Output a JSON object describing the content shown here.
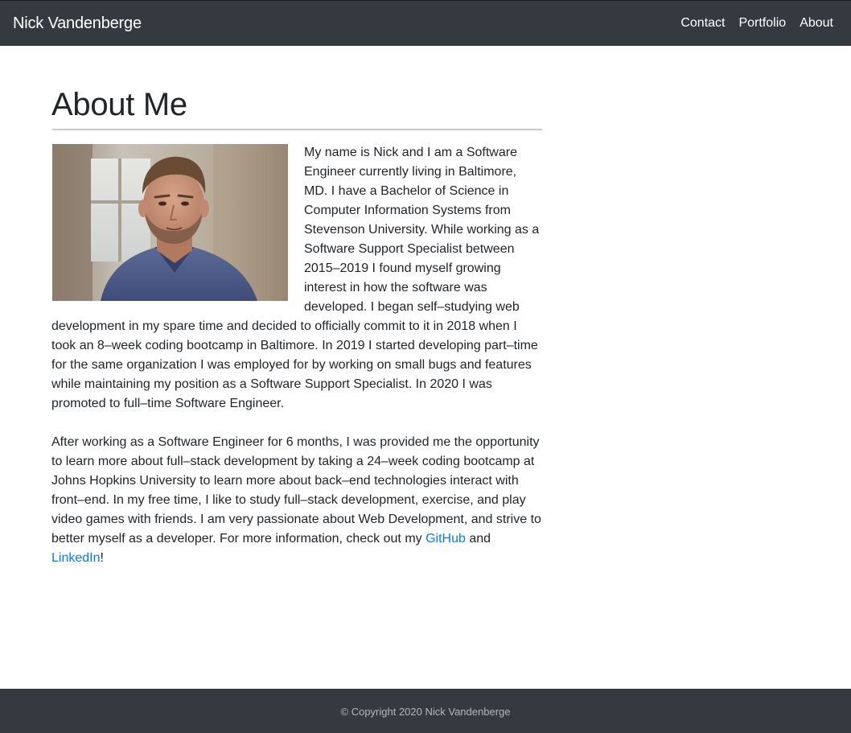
{
  "navbar": {
    "brand": "Nick Vandenberge",
    "links": [
      {
        "label": "Contact"
      },
      {
        "label": "Portfolio"
      },
      {
        "label": "About"
      }
    ]
  },
  "main": {
    "title": "About Me",
    "photo_icon": "portrait-photo",
    "paragraph1": "My name is Nick and I am a Software Engineer currently living in Baltimore, MD. I have a Bachelor of Science in Computer Information Systems from Stevenson University. While working as a Software Support Specialist between 2015–2019 I found myself growing interest in how the software was developed. I began self–studying web development in my spare time and decided to officially commit to it in 2018 when I took an 8–week coding bootcamp in Baltimore. In 2019 I started developing part–time for the same organization I was employed for by working on small bugs and features while maintaining my position as a Software Support Specialist. In 2020 I was promoted to full–time Software Engineer.",
    "paragraph2": {
      "text": "After working as a Software Engineer for 6 months, I was provided me the opportunity to learn more about full–stack development by taking a 24–week coding bootcamp at Johns Hopkins University to learn more about back–end technologies interact with front–end. In my free time, I like to study full–stack development, exercise, and play video games with friends. I am very passionate about Web Development, and strive to better myself as a developer. For more information, check out my ",
      "github_label": "GitHub",
      "and_text": " and ",
      "linkedin_label": "LinkedIn",
      "end_text": "!"
    }
  },
  "footer": {
    "text": "© Copyright 2020 Nick Vandenberge"
  },
  "colors": {
    "navbar_bg": "#343a40",
    "link": "#007bff",
    "text": "#212529"
  }
}
